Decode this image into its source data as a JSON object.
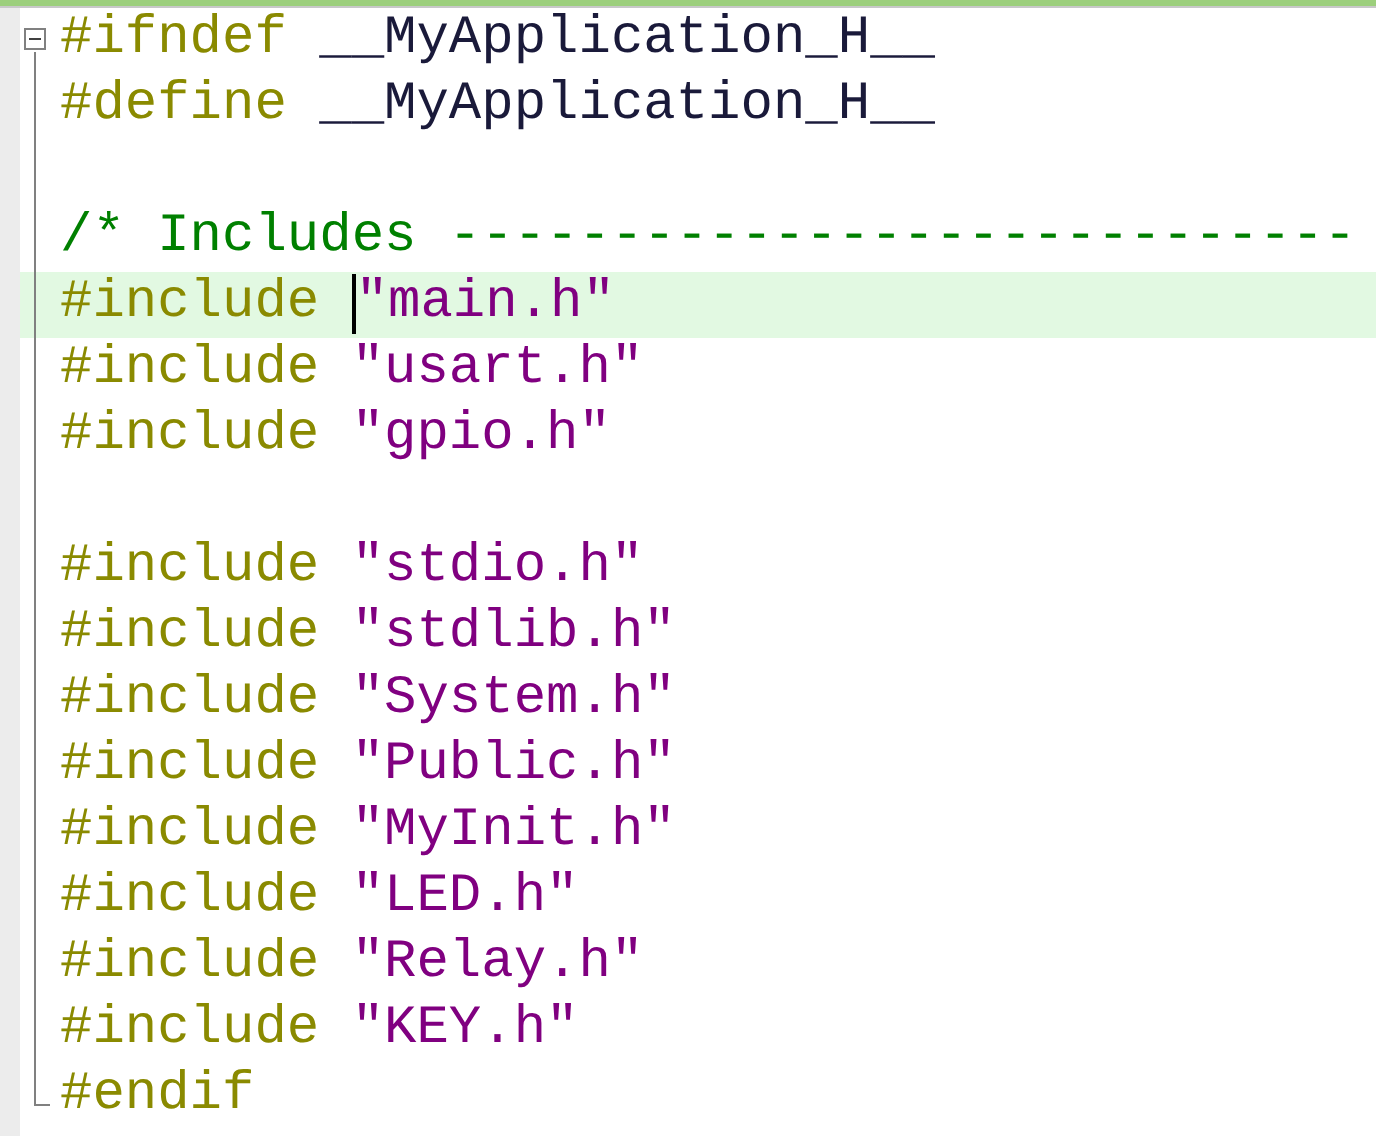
{
  "editor": {
    "lines": [
      {
        "kind": "fold_start",
        "highlighted": false,
        "segments": [
          {
            "text": "#ifndef ",
            "kind": "keyword"
          },
          {
            "text": "__MyApplication_H__",
            "kind": "macro"
          }
        ]
      },
      {
        "kind": "fold_inside",
        "highlighted": false,
        "segments": [
          {
            "text": "#define ",
            "kind": "keyword"
          },
          {
            "text": "__MyApplication_H__",
            "kind": "macro"
          }
        ]
      },
      {
        "kind": "fold_inside",
        "highlighted": false
      },
      {
        "kind": "fold_inside",
        "highlighted": false,
        "segments": [
          {
            "text": "/* Includes ----------------------------",
            "kind": "comment"
          }
        ]
      },
      {
        "kind": "fold_inside",
        "highlighted": true,
        "segments": [
          {
            "text": "#include ",
            "kind": "keyword"
          },
          {
            "text": "\"main.h\"",
            "kind": "string",
            "caret_before": true
          }
        ]
      },
      {
        "kind": "fold_inside",
        "highlighted": false,
        "segments": [
          {
            "text": "#include ",
            "kind": "keyword"
          },
          {
            "text": "\"usart.h\"",
            "kind": "string"
          }
        ]
      },
      {
        "kind": "fold_inside",
        "highlighted": false,
        "segments": [
          {
            "text": "#include ",
            "kind": "keyword"
          },
          {
            "text": "\"gpio.h\"",
            "kind": "string"
          }
        ]
      },
      {
        "kind": "fold_inside",
        "highlighted": false
      },
      {
        "kind": "fold_inside",
        "highlighted": false,
        "segments": [
          {
            "text": "#include ",
            "kind": "keyword"
          },
          {
            "text": "\"stdio.h\"",
            "kind": "string"
          }
        ]
      },
      {
        "kind": "fold_inside",
        "highlighted": false,
        "segments": [
          {
            "text": "#include ",
            "kind": "keyword"
          },
          {
            "text": "\"stdlib.h\"",
            "kind": "string"
          }
        ]
      },
      {
        "kind": "fold_inside",
        "highlighted": false,
        "segments": [
          {
            "text": "#include ",
            "kind": "keyword"
          },
          {
            "text": "\"System.h\"",
            "kind": "string"
          }
        ]
      },
      {
        "kind": "fold_inside",
        "highlighted": false,
        "segments": [
          {
            "text": "#include ",
            "kind": "keyword"
          },
          {
            "text": "\"Public.h\"",
            "kind": "string"
          }
        ]
      },
      {
        "kind": "fold_inside",
        "highlighted": false,
        "segments": [
          {
            "text": "#include ",
            "kind": "keyword"
          },
          {
            "text": "\"MyInit.h\"",
            "kind": "string"
          }
        ]
      },
      {
        "kind": "fold_inside",
        "highlighted": false,
        "segments": [
          {
            "text": "#include ",
            "kind": "keyword"
          },
          {
            "text": "\"LED.h\"",
            "kind": "string"
          }
        ]
      },
      {
        "kind": "fold_inside",
        "highlighted": false,
        "segments": [
          {
            "text": "#include ",
            "kind": "keyword"
          },
          {
            "text": "\"Relay.h\"",
            "kind": "string"
          }
        ]
      },
      {
        "kind": "fold_inside",
        "highlighted": false,
        "segments": [
          {
            "text": "#include ",
            "kind": "keyword"
          },
          {
            "text": "\"KEY.h\"",
            "kind": "string"
          }
        ]
      },
      {
        "kind": "fold_end",
        "highlighted": false,
        "segments": [
          {
            "text": "#endif",
            "kind": "keyword"
          }
        ]
      }
    ]
  }
}
